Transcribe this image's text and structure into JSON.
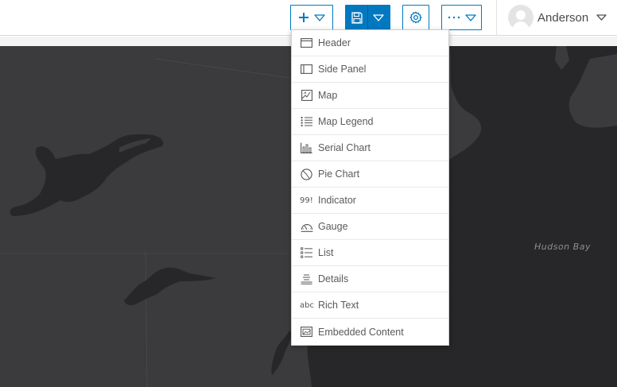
{
  "toolbar": {
    "add_icon": "plus-icon",
    "save_icon": "floppy-disk-icon",
    "settings_icon": "gear-icon",
    "more_icon": "ellipsis-icon",
    "accent": "#0079c1"
  },
  "user": {
    "name": "Anderson"
  },
  "add_menu": {
    "items": [
      {
        "label": "Header",
        "icon": "header-icon"
      },
      {
        "label": "Side Panel",
        "icon": "side-panel-icon"
      },
      {
        "label": "Map",
        "icon": "map-icon"
      },
      {
        "label": "Map Legend",
        "icon": "legend-icon"
      },
      {
        "label": "Serial Chart",
        "icon": "serial-chart-icon"
      },
      {
        "label": "Pie Chart",
        "icon": "pie-chart-icon"
      },
      {
        "label": "Indicator",
        "icon": "indicator-icon",
        "glyph": "99!"
      },
      {
        "label": "Gauge",
        "icon": "gauge-icon"
      },
      {
        "label": "List",
        "icon": "list-icon"
      },
      {
        "label": "Details",
        "icon": "details-icon"
      },
      {
        "label": "Rich Text",
        "icon": "rich-text-icon",
        "glyph": "abc"
      },
      {
        "label": "Embedded Content",
        "icon": "embedded-content-icon"
      }
    ]
  },
  "map": {
    "labels": {
      "hudson_bay": "Hudson Bay"
    },
    "colors": {
      "land": "#3b3b3d",
      "water": "#27272a"
    }
  }
}
